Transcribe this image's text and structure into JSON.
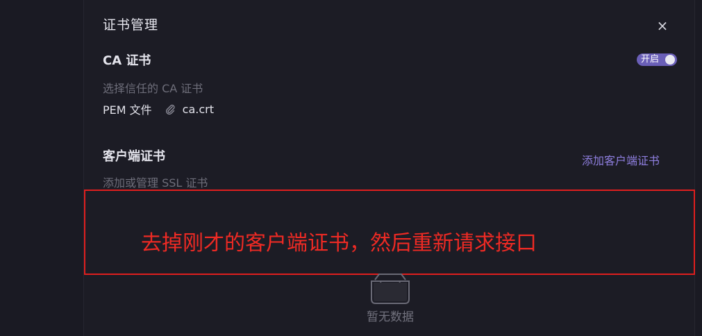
{
  "drawer": {
    "title": "证书管理",
    "close_glyph": "×"
  },
  "ca_section": {
    "title": "CA 证书",
    "description": "选择信任的 CA 证书",
    "toggle_label": "开启",
    "toggle_on": true,
    "file_type_label": "PEM 文件",
    "file_name": "ca.crt"
  },
  "client_section": {
    "title": "客户端证书",
    "description": "添加或管理 SSL 证书",
    "add_button_label": "添加客户端证书"
  },
  "annotation": {
    "text": "去掉刚才的客户端证书，然后重新请求接口"
  },
  "empty_state": {
    "text": "暂无数据"
  },
  "colors": {
    "accent": "#8f7fe0",
    "toggle": "#6a5fb8",
    "annotation_red": "#e01e1e"
  },
  "icons": {
    "close": "close-icon",
    "attachment": "paperclip-icon",
    "empty": "empty-inbox-icon"
  }
}
